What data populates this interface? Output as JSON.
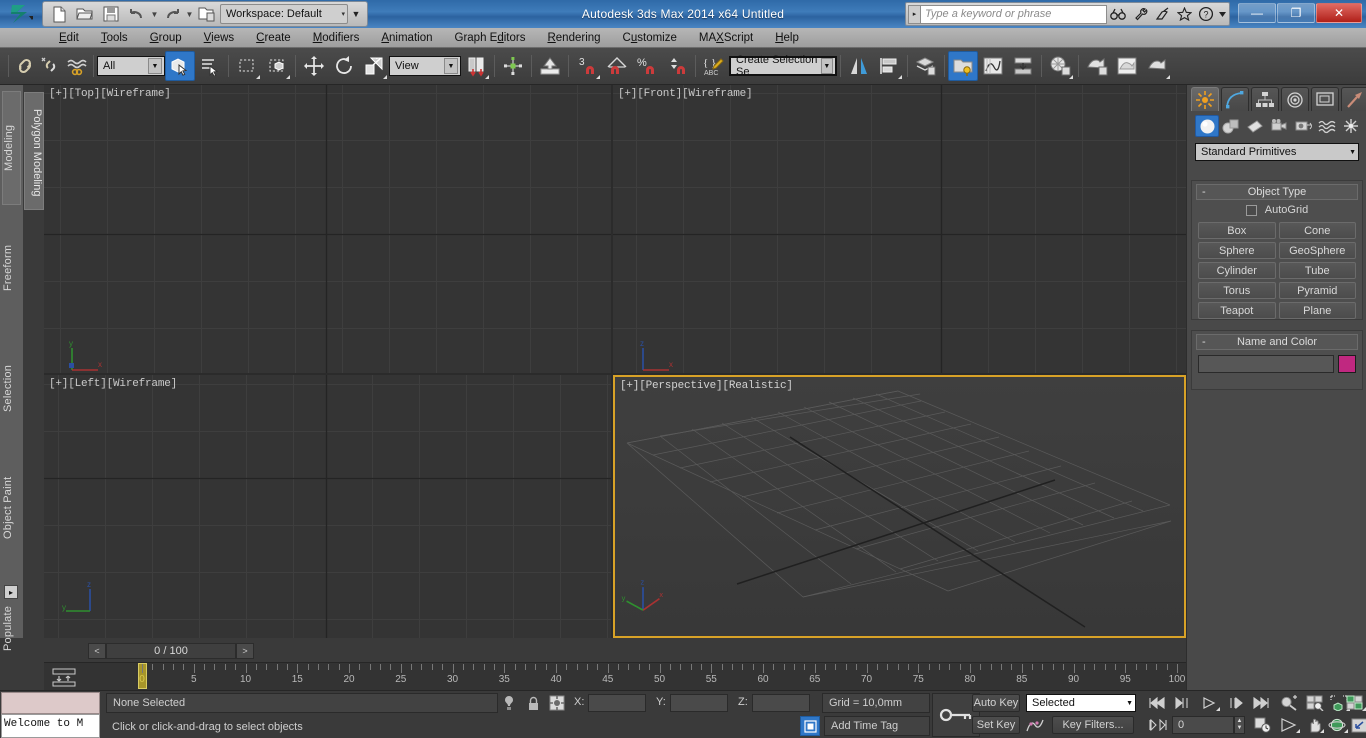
{
  "titlebar": {
    "app_title": "Autodesk 3ds Max  2014 x64      Untitled",
    "workspace_label": "Workspace: Default",
    "workspace_arrow": "▾",
    "more_arrow": "▼",
    "minimize": "—",
    "restore": "❐",
    "close": "✕",
    "qat": [
      "new-icon",
      "open-icon",
      "save-icon",
      "undo-icon",
      "redo-icon",
      "project-folder-icon"
    ],
    "search": {
      "placeholder": "Type a keyword or phrase",
      "value": "",
      "flyout_arrow": "▸",
      "icons": [
        "binoculars-icon",
        "wrench-icon",
        "satellite-icon",
        "star-icon",
        "help-icon",
        "help-dropdown-arrow"
      ]
    }
  },
  "menubar": {
    "items": [
      {
        "pre": "",
        "hot": "E",
        "post": "dit"
      },
      {
        "pre": "",
        "hot": "T",
        "post": "ools"
      },
      {
        "pre": "",
        "hot": "G",
        "post": "roup"
      },
      {
        "pre": "",
        "hot": "V",
        "post": "iews"
      },
      {
        "pre": "",
        "hot": "C",
        "post": "reate"
      },
      {
        "pre": "",
        "hot": "M",
        "post": "odifiers"
      },
      {
        "pre": "",
        "hot": "A",
        "post": "nimation"
      },
      {
        "pre": "Graph E",
        "hot": "d",
        "post": "itors"
      },
      {
        "pre": "",
        "hot": "R",
        "post": "endering"
      },
      {
        "pre": "C",
        "hot": "u",
        "post": "stomize"
      },
      {
        "pre": "MA",
        "hot": "X",
        "post": "Script"
      },
      {
        "pre": "",
        "hot": "H",
        "post": "elp"
      }
    ]
  },
  "toolbar": {
    "select_filter": "All",
    "reference_coord": "View",
    "named_selection_set": "Create Selection Se",
    "dropdown_arrow": "▼",
    "snap_label_3": "3",
    "snap_label_percent": "%",
    "buttons": [
      "select-link-icon",
      "unlink-icon",
      "bind-space-warp-icon",
      "select-object-icon",
      "select-by-name-icon",
      "rectangular-selection-region-icon",
      "window-crossing-icon",
      "select-and-move-icon",
      "select-and-rotate-icon",
      "select-and-scale-icon",
      "use-pivot-point-center-icon",
      "select-and-manipulate-icon",
      "snaps-toggle-icon",
      "angle-snap-toggle-icon",
      "percent-snap-toggle-icon",
      "spinner-snap-toggle-icon",
      "edit-named-selection-sets-icon",
      "mirror-icon",
      "align-icon",
      "layer-explorer-icon",
      "scene-explorer-icon",
      "curve-editor-icon",
      "schematic-view-icon",
      "material-editor-icon",
      "render-setup-icon",
      "rendered-frame-window-icon",
      "render-production-icon"
    ]
  },
  "left_rail": {
    "tabs": [
      "Modeling",
      "Freeform",
      "Selection",
      "Object Paint",
      "Populate"
    ],
    "selected_tab": "Modeling",
    "sub_tab": "Polygon Modeling",
    "handle_glyph": "▸"
  },
  "viewports": [
    {
      "name": "top",
      "label": "[+][Top][Wireframe]",
      "active": false
    },
    {
      "name": "front",
      "label": "[+][Front][Wireframe]",
      "active": false
    },
    {
      "name": "left",
      "label": "[+][Left][Wireframe]",
      "active": false
    },
    {
      "name": "perspective",
      "label": "[+][Perspective][Realistic]",
      "active": true
    }
  ],
  "axis_labels": {
    "x": "x",
    "y": "y",
    "z": "z"
  },
  "time_slider": {
    "prev_label": "<",
    "next_label": ">",
    "frame_readout": "0 / 100",
    "ruler_ticks": [
      0,
      5,
      10,
      15,
      20,
      25,
      30,
      35,
      40,
      45,
      50,
      55,
      60,
      65,
      70,
      75,
      80,
      85,
      90,
      95,
      100
    ],
    "current_frame": 0
  },
  "maxscript": {
    "mini_listener_value": "",
    "log_text": "Welcome to M"
  },
  "status": {
    "selection_text": "None Selected",
    "prompt_text": "Click or click-and-drag to select objects",
    "x_label": "X:",
    "y_label": "Y:",
    "z_label": "Z:",
    "x_value": "",
    "y_value": "",
    "z_value": "",
    "grid_text": "Grid = 10,0mm",
    "add_time_tag": "Add Time Tag",
    "lock_icon": "lock-selection-icon",
    "bulb_icon": "isolate-selection-icon",
    "absolute_mode_icon": "absolute-relative-transform-toggle-icon",
    "adaptive_degradation_icon": "adaptive-degradation-toggle-icon"
  },
  "animation": {
    "key_mode_icon": "key-toggle-icon",
    "auto_key": "Auto Key",
    "set_key": "Set Key",
    "key_filters": "Key Filters...",
    "selection_list": "Selected",
    "dropdown_arrow": "▼",
    "curve_icon": "set-key-curve-icon",
    "playback": {
      "go_to_start": "go-to-start-icon",
      "previous_frame": "previous-frame-icon",
      "play": "play-animation-icon",
      "next_frame": "next-frame-icon",
      "go_to_end": "go-to-end-icon",
      "key_mode_prev": "key-mode-prev-icon",
      "key_mode_next": "key-mode-next-icon"
    },
    "current_frame_value": "0",
    "spinner_up": "▲",
    "spinner_down": "▼",
    "time_config_icon": "time-configuration-icon"
  },
  "viewport_nav": {
    "zoom": "zoom-icon",
    "zoom_all": "zoom-all-icon",
    "zoom_extents": "zoom-extents-icon",
    "zoom_extents_all": "zoom-extents-all-icon",
    "field_of_view": "field-of-view-icon",
    "pan": "pan-view-icon",
    "orbit": "orbit-icon",
    "maximize_viewport": "maximize-viewport-toggle-icon"
  },
  "command_panel": {
    "tabs": [
      "create-tab",
      "modify-tab",
      "hierarchy-tab",
      "motion-tab",
      "display-tab",
      "utilities-tab"
    ],
    "selected_tab": "create-tab",
    "sub_icons": [
      "geometry-icon",
      "shapes-icon",
      "lights-icon",
      "cameras-icon",
      "helpers-icon",
      "space-warps-icon",
      "systems-icon"
    ],
    "selected_sub_icon": "geometry-icon",
    "category": "Standard Primitives",
    "rollouts": [
      {
        "title": "Object Type",
        "collapse_glyph": "-",
        "autogrid_label": "AutoGrid",
        "autogrid_checked": false,
        "buttons": [
          "Box",
          "Cone",
          "Sphere",
          "GeoSphere",
          "Cylinder",
          "Tube",
          "Torus",
          "Pyramid",
          "Teapot",
          "Plane"
        ]
      },
      {
        "title": "Name and Color",
        "collapse_glyph": "-",
        "name_value": "",
        "color": "#c02880"
      }
    ]
  },
  "colors": {
    "title_blue": "#3f7cba",
    "accent_orange": "#d8a227",
    "active_blue": "#2f77c8",
    "panel_grey": "#494949",
    "viewport_grey": "#343434"
  }
}
